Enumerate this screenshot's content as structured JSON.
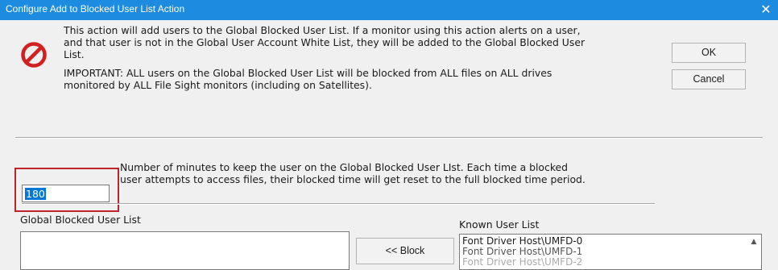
{
  "window": {
    "title": "Configure Add to Blocked User List Action",
    "close_glyph": "✕"
  },
  "icons": {
    "prohibited": "no-entry-icon",
    "prohibited_color": "#d22020"
  },
  "description": {
    "line1": "This action will add users to the Global Blocked User List.  If a monitor using this action alerts on a user,",
    "line2": "and that user is not in the Global User Account White List, they will be added to the Global Blocked User",
    "line3": "List.",
    "important1": "IMPORTANT: ALL users on the Global Blocked User List will be blocked from ALL files on ALL drives",
    "important2": "monitored by ALL File Sight monitors (including on Satellites)."
  },
  "buttons": {
    "ok": "OK",
    "cancel": "Cancel",
    "block": "<< Block"
  },
  "minutes": {
    "value": "180",
    "help1": "Number of minutes to keep the user on the Global Blocked User LIst.  Each time a blocked",
    "help2": "user attempts to access files, their blocked time will get reset to the full blocked time period."
  },
  "blocked_list": {
    "label": "Global Blocked User List",
    "items": []
  },
  "known_list": {
    "label": "Known User List",
    "items": [
      "Font Driver Host\\UMFD-0",
      "Font Driver Host\\UMFD-1",
      "Font Driver Host\\UMFD-2"
    ]
  },
  "colors": {
    "titlebar": "#1c8be0",
    "highlight_box": "#c0242b",
    "selection": "#0078d7"
  }
}
